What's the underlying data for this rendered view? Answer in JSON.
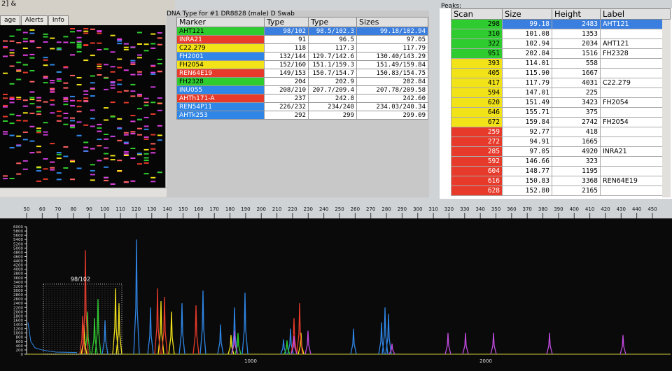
{
  "gel": {
    "title": "2] &",
    "tabs": [
      "age",
      "Alerts",
      "Info"
    ]
  },
  "dna": {
    "caption": "DNA Type for #1 DR8828 (male) D Swab",
    "headers": [
      "Marker",
      "Type",
      "Type",
      "Sizes"
    ],
    "rows": [
      {
        "marker": "AHT121",
        "type1": "98/102",
        "type2": "98.5/102.3",
        "sizes": "99.18/102.94",
        "color": "#2ecc2e",
        "selected": true
      },
      {
        "marker": "INRA21",
        "type1": "91",
        "type2": "96.5",
        "sizes": "97.05",
        "color": "#e83a2a",
        "selected": false
      },
      {
        "marker": "C22.279",
        "type1": "118",
        "type2": "117.3",
        "sizes": "117.79",
        "color": "#f2e218",
        "selected": false
      },
      {
        "marker": "FH2001",
        "type1": "132/144",
        "type2": "129.7/142.6",
        "sizes": "130.40/143.29",
        "color": "#2f86e6",
        "selected": false
      },
      {
        "marker": "FH2054",
        "type1": "152/160",
        "type2": "151.1/159.3",
        "sizes": "151.49/159.84",
        "color": "#f2e218",
        "selected": false
      },
      {
        "marker": "REN64E19",
        "type1": "149/153",
        "type2": "150.7/154.7",
        "sizes": "150.83/154.75",
        "color": "#e83a2a",
        "selected": false
      },
      {
        "marker": "FH2328",
        "type1": "204",
        "type2": "202.9",
        "sizes": "202.84",
        "color": "#2ecc2e",
        "selected": false
      },
      {
        "marker": "INU055",
        "type1": "208/210",
        "type2": "207.7/209.4",
        "sizes": "207.78/209.58",
        "color": "#2f86e6",
        "selected": false
      },
      {
        "marker": "AHTh171-A",
        "type1": "237",
        "type2": "242.8",
        "sizes": "242.60",
        "color": "#e83a2a",
        "selected": false
      },
      {
        "marker": "REN54P11",
        "type1": "226/232",
        "type2": "234/240",
        "sizes": "234.03/240.34",
        "color": "#2f86e6",
        "selected": false
      },
      {
        "marker": "AHTk253",
        "type1": "292",
        "type2": "299",
        "sizes": "299.09",
        "color": "#2f86e6",
        "selected": false
      }
    ]
  },
  "peaks": {
    "caption": "Peaks:",
    "headers": [
      "Scan",
      "Size",
      "Height",
      "Label"
    ],
    "rows": [
      {
        "scan": "298",
        "size": "99.18",
        "height": "2483",
        "label": "AHT121",
        "color": "#2ecc2e",
        "selected": true
      },
      {
        "scan": "310",
        "size": "101.08",
        "height": "1353",
        "label": "",
        "color": "#2ecc2e",
        "selected": false
      },
      {
        "scan": "322",
        "size": "102.94",
        "height": "2034",
        "label": "AHT121",
        "color": "#2ecc2e",
        "selected": false
      },
      {
        "scan": "951",
        "size": "202.84",
        "height": "1516",
        "label": "FH2328",
        "color": "#2ecc2e",
        "selected": false
      },
      {
        "scan": "393",
        "size": "114.01",
        "height": "558",
        "label": "",
        "color": "#f2e218",
        "selected": false
      },
      {
        "scan": "405",
        "size": "115.90",
        "height": "1667",
        "label": "",
        "color": "#f2e218",
        "selected": false
      },
      {
        "scan": "417",
        "size": "117.79",
        "height": "4031",
        "label": "C22.279",
        "color": "#f2e218",
        "selected": false
      },
      {
        "scan": "594",
        "size": "147.01",
        "height": "225",
        "label": "",
        "color": "#f2e218",
        "selected": false
      },
      {
        "scan": "620",
        "size": "151.49",
        "height": "3423",
        "label": "FH2054",
        "color": "#f2e218",
        "selected": false
      },
      {
        "scan": "646",
        "size": "155.71",
        "height": "375",
        "label": "",
        "color": "#f2e218",
        "selected": false
      },
      {
        "scan": "672",
        "size": "159.84",
        "height": "2742",
        "label": "FH2054",
        "color": "#f2e218",
        "selected": false
      },
      {
        "scan": "259",
        "size": "92.77",
        "height": "418",
        "label": "",
        "color": "#e83a2a",
        "selected": false
      },
      {
        "scan": "272",
        "size": "94.91",
        "height": "1665",
        "label": "",
        "color": "#e83a2a",
        "selected": false
      },
      {
        "scan": "285",
        "size": "97.05",
        "height": "4920",
        "label": "INRA21",
        "color": "#e83a2a",
        "selected": false
      },
      {
        "scan": "592",
        "size": "146.66",
        "height": "323",
        "label": "",
        "color": "#e83a2a",
        "selected": false
      },
      {
        "scan": "604",
        "size": "148.77",
        "height": "1195",
        "label": "",
        "color": "#e83a2a",
        "selected": false
      },
      {
        "scan": "616",
        "size": "150.83",
        "height": "3368",
        "label": "REN64E19",
        "color": "#e83a2a",
        "selected": false
      },
      {
        "scan": "628",
        "size": "152.80",
        "height": "2165",
        "label": "",
        "color": "#e83a2a",
        "selected": false
      }
    ]
  },
  "chart_data": {
    "type": "line",
    "title": "",
    "xlabel": "",
    "ylabel": "",
    "x_size_ticks": [
      50,
      60,
      70,
      80,
      90,
      100,
      110,
      120,
      130,
      140,
      150,
      160,
      170,
      180,
      190,
      200,
      210,
      220,
      230,
      240,
      250,
      260,
      270,
      280,
      290,
      300,
      310,
      320,
      330,
      340,
      350,
      360,
      370,
      380,
      390,
      400,
      410,
      420,
      430,
      440,
      450
    ],
    "x_scan_ticks": [
      1000,
      2000
    ],
    "ylim": [
      0,
      6000
    ],
    "y_ticks": [
      0,
      200,
      400,
      600,
      800,
      1000,
      1200,
      1400,
      1600,
      1800,
      2000,
      2200,
      2400,
      2600,
      2800,
      3000,
      3200,
      3400,
      3600,
      3800,
      4000,
      4200,
      4400,
      4600,
      4800,
      5000,
      5200,
      5400,
      5600,
      5800,
      6000
    ],
    "annotation": "98/102",
    "series": [
      {
        "name": "blue",
        "color": "#2f86e6",
        "peaks": [
          [
            150,
            1600
          ],
          [
            195,
            5400
          ],
          [
            215,
            2200
          ],
          [
            260,
            2400
          ],
          [
            290,
            3000
          ],
          [
            315,
            1400
          ],
          [
            335,
            2200
          ],
          [
            350,
            2900
          ],
          [
            405,
            700
          ],
          [
            415,
            1200
          ],
          [
            505,
            1200
          ],
          [
            545,
            1500
          ],
          [
            550,
            2200
          ],
          [
            555,
            1900
          ]
        ]
      },
      {
        "name": "green",
        "color": "#2ecc2e",
        "peaks": [
          [
            125,
            2000
          ],
          [
            135,
            1700
          ],
          [
            140,
            2600
          ],
          [
            340,
            1000
          ],
          [
            410,
            650
          ]
        ]
      },
      {
        "name": "yellow",
        "color": "#f2e218",
        "peaks": [
          [
            120,
            1400
          ],
          [
            165,
            3100
          ],
          [
            170,
            2400
          ],
          [
            230,
            2500
          ],
          [
            245,
            2000
          ],
          [
            330,
            900
          ],
          [
            430,
            1000
          ]
        ]
      },
      {
        "name": "red",
        "color": "#e83a2a",
        "peaks": [
          [
            118,
            1800
          ],
          [
            122,
            4900
          ],
          [
            225,
            3100
          ],
          [
            235,
            2700
          ],
          [
            280,
            2300
          ],
          [
            420,
            1700
          ],
          [
            428,
            2400
          ]
        ]
      },
      {
        "name": "purple",
        "color": "#c24be0",
        "peaks": [
          [
            335,
            1100
          ],
          [
            420,
            850
          ],
          [
            440,
            1100
          ],
          [
            560,
            500
          ],
          [
            640,
            1000
          ],
          [
            665,
            1000
          ],
          [
            705,
            1000
          ],
          [
            785,
            1000
          ],
          [
            890,
            900
          ]
        ]
      }
    ]
  }
}
